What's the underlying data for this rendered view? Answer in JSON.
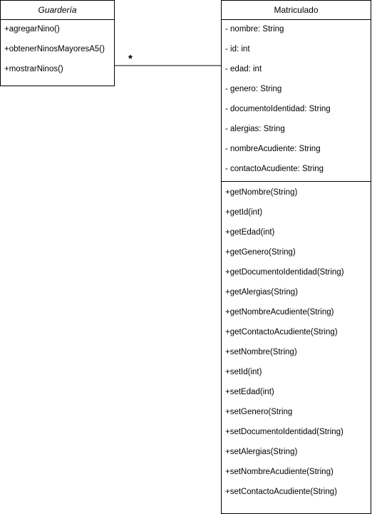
{
  "guarderia": {
    "name": "Guardería",
    "methods": [
      "+agregarNino()",
      "+obtenerNinosMayoresA5()",
      "+mostrarNinos()"
    ]
  },
  "matriculado": {
    "name": "Matriculado",
    "attributes": [
      "- nombre: String",
      "- id: int",
      "- edad: int",
      "- genero: String",
      "- documentoIdentidad: String",
      "- alergias: String",
      "- nombreAcudiente: String",
      "- contactoAcudiente: String"
    ],
    "methods": [
      "+getNombre(String)",
      "+getId(int)",
      "+getEdad(int)",
      "+getGenero(String)",
      "+getDocumentoIdentidad(String)",
      "+getAlergias(String)",
      "+getNombreAcudiente(String)",
      "+getContactoAcudiente(String)",
      "+setNombre(String)",
      "+setId(int)",
      "+setEdad(int)",
      "+setGenero(String",
      "+setDocumentoIdentidad(String)",
      "+setAlergias(String)",
      "+setNombreAcudiente(String)",
      "+setContactoAcudiente(String)"
    ]
  },
  "association": {
    "multiplicity": "*"
  }
}
